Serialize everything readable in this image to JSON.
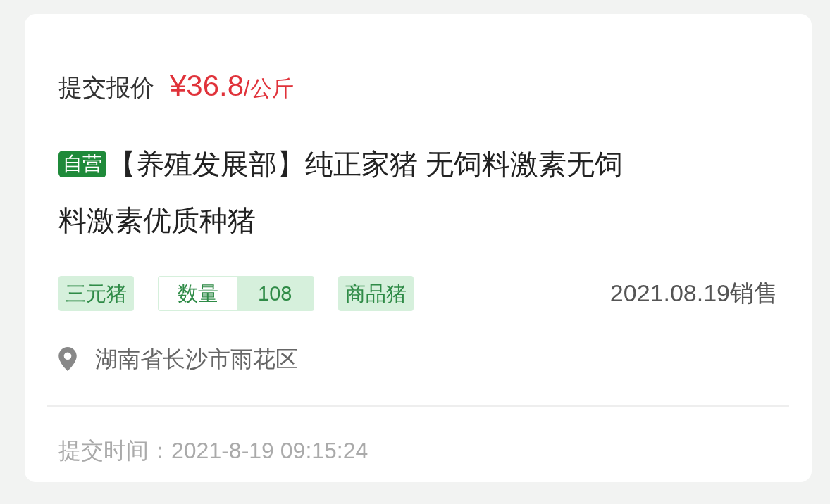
{
  "header": {
    "label": "提交报价",
    "price": "¥36.8",
    "unit": "/公斤"
  },
  "product": {
    "badge": "自营",
    "title_lines": [
      "【养殖发展部】纯正家猪 无饲料激素无饲",
      "料激素优质种猪"
    ]
  },
  "tags": [
    {
      "kind": "tag",
      "text": "三元猪"
    },
    {
      "kind": "pair",
      "label": "数量",
      "value": "108"
    },
    {
      "kind": "tag",
      "text": "商品猪"
    }
  ],
  "sale_date": "2021.08.19销售",
  "location": "湖南省长沙市雨花区",
  "submit_time": "提交时间：2021-8-19 09:15:24"
}
